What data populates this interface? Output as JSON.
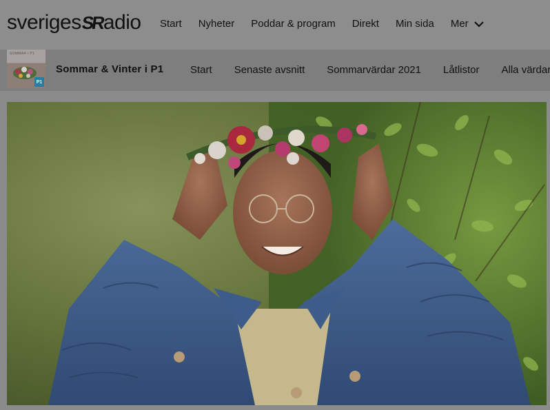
{
  "site": {
    "logo_text_left": "sveriges",
    "logo_mark": "SR",
    "logo_text_right": "adio"
  },
  "main_nav": {
    "items": [
      "Start",
      "Nyheter",
      "Poddar & program",
      "Direkt",
      "Min sida",
      "Mer"
    ],
    "more_icon": "chevron-down-icon"
  },
  "program": {
    "thumb_label": "SOMMAR I P1",
    "thumb_badge": "P1",
    "title": "Sommar & Vinter i P1",
    "nav": [
      "Start",
      "Senaste avsnitt",
      "Sommarvärdar 2021",
      "Låtlistor",
      "Alla värdar"
    ]
  },
  "hero": {
    "image_label": "hero-photo"
  }
}
